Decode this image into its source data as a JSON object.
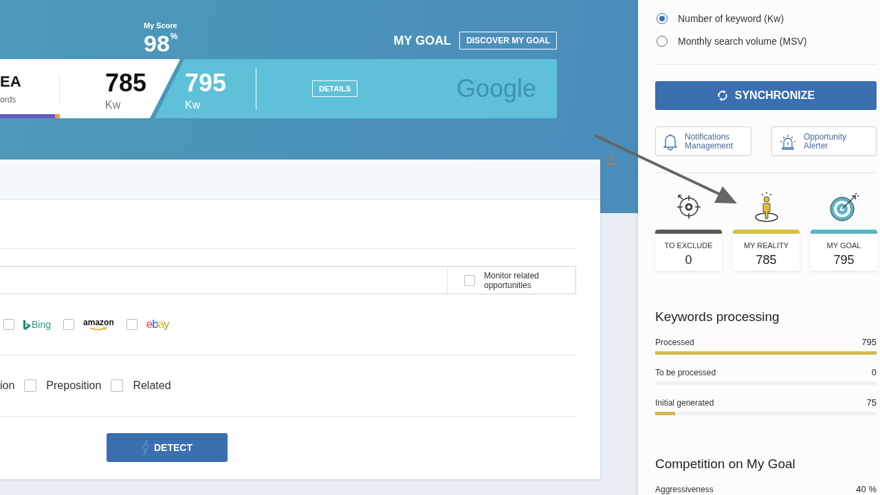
{
  "score_header": {
    "partial_title": "EA",
    "partial_subtitle": "ords",
    "score_label": "My Score",
    "score_value": "98",
    "score_unit": "%",
    "reality_value": "785",
    "reality_unit": "Kw",
    "goal_value": "795",
    "goal_unit": "Kw",
    "details_button": "DETAILS",
    "engine": "Google",
    "goal_title": "MY GOAL",
    "discover_button": "DISCOVER MY GOAL"
  },
  "form": {
    "monitor_checkbox": {
      "label": "Monitor related opportunities",
      "checked": false
    },
    "engines": [
      {
        "kind": "bing",
        "label": "Bing",
        "checked": false
      },
      {
        "kind": "amazon",
        "label": "amazon",
        "checked": false
      },
      {
        "kind": "ebay",
        "label": "ebay",
        "checked": false
      }
    ],
    "partial_option": "ion",
    "options": [
      {
        "label": "Preposition",
        "checked": false
      },
      {
        "label": "Related",
        "checked": false
      }
    ],
    "detect_button": "DETECT"
  },
  "sidebar": {
    "display_mode": [
      {
        "label": "Number of keyword (Kw)",
        "selected": true
      },
      {
        "label": "Monthly search volume (MSV)",
        "selected": false
      }
    ],
    "synchronize_button": "SYNCHRONIZE",
    "tools": [
      {
        "kind": "bell",
        "label": "Notifications Management"
      },
      {
        "kind": "alarm",
        "label": "Opportunity Alerter"
      }
    ],
    "counters": [
      {
        "kind": "exclude",
        "label": "TO EXCLUDE",
        "value": "0",
        "color": "#58585a"
      },
      {
        "kind": "reality",
        "label": "MY REALITY",
        "value": "785",
        "color": "#d9bf3a"
      },
      {
        "kind": "goal",
        "label": "MY GOAL",
        "value": "795",
        "color": "#5bb4c4"
      }
    ],
    "processing_title": "Keywords processing",
    "processing": [
      {
        "label": "Processed",
        "value": "795",
        "level": 1
      },
      {
        "label": "To be processed",
        "value": "0",
        "level": 0
      },
      {
        "label": "Initial generated",
        "value": "75",
        "level": 0.09
      }
    ],
    "competition_title": "Competition on My Goal",
    "competition": [
      {
        "label": "Aggressiveness",
        "value": "40 %"
      }
    ]
  }
}
